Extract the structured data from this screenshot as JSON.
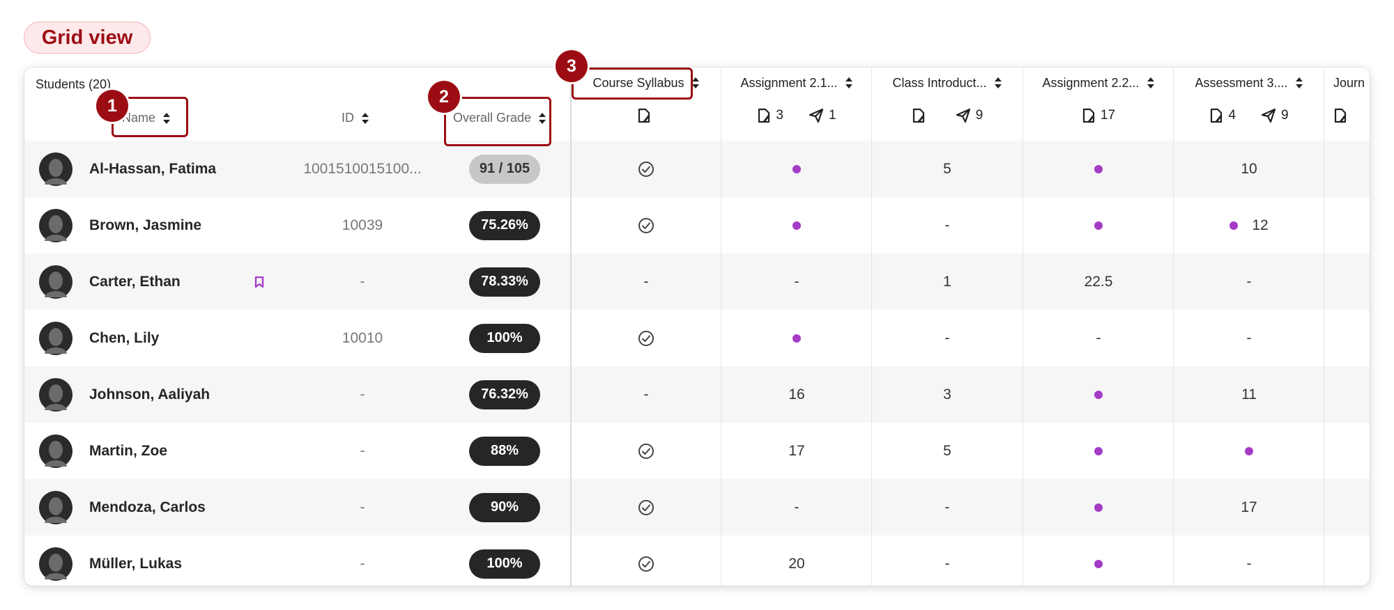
{
  "title": "Grid view",
  "header": {
    "students_label": "Students (20)",
    "name_label": "Name",
    "id_label": "ID",
    "overall_label": "Overall Grade"
  },
  "columns": [
    {
      "label": "Course Syllabus",
      "icons": [
        {
          "name": "document-icon",
          "count": ""
        }
      ]
    },
    {
      "label": "Assignment 2.1...",
      "icons": [
        {
          "name": "document-icon",
          "count": "3"
        },
        {
          "name": "send-icon",
          "count": "1"
        }
      ]
    },
    {
      "label": "Class Introduct...",
      "icons": [
        {
          "name": "document-icon",
          "count": ""
        },
        {
          "name": "send-icon",
          "count": "9"
        }
      ]
    },
    {
      "label": "Assignment 2.2...",
      "icons": [
        {
          "name": "document-icon",
          "count": "17"
        }
      ]
    },
    {
      "label": "Assessment 3....",
      "icons": [
        {
          "name": "document-icon",
          "count": "4"
        },
        {
          "name": "send-icon",
          "count": "9"
        }
      ]
    },
    {
      "label": "Journ",
      "icons": [
        {
          "name": "document-icon",
          "count": ""
        }
      ]
    }
  ],
  "students": [
    {
      "name": "Al-Hassan, Fatima",
      "id": "1001510015100...",
      "grade": "91 / 105",
      "grade_style": "light",
      "flag": false,
      "cells": [
        {
          "check": true
        },
        {
          "dot": true
        },
        {
          "text": "5"
        },
        {
          "dot": true
        },
        {
          "text": "10"
        }
      ]
    },
    {
      "name": "Brown, Jasmine",
      "id": "10039",
      "grade": "75.26%",
      "grade_style": "dark",
      "flag": false,
      "cells": [
        {
          "check": true
        },
        {
          "dot": true
        },
        {
          "text": "-"
        },
        {
          "dot": true
        },
        {
          "dot": true,
          "text": "12"
        }
      ]
    },
    {
      "name": "Carter, Ethan",
      "id": "-",
      "grade": "78.33%",
      "grade_style": "dark",
      "flag": true,
      "cells": [
        {
          "text": "-"
        },
        {
          "text": "-"
        },
        {
          "text": "1"
        },
        {
          "text": "22.5"
        },
        {
          "text": "-"
        }
      ]
    },
    {
      "name": "Chen, Lily",
      "id": "10010",
      "grade": "100%",
      "grade_style": "dark",
      "flag": false,
      "cells": [
        {
          "check": true
        },
        {
          "dot": true
        },
        {
          "text": "-"
        },
        {
          "text": "-"
        },
        {
          "text": "-"
        }
      ]
    },
    {
      "name": "Johnson, Aaliyah",
      "id": "-",
      "grade": "76.32%",
      "grade_style": "dark",
      "flag": false,
      "cells": [
        {
          "text": "-"
        },
        {
          "text": "16"
        },
        {
          "text": "3"
        },
        {
          "dot": true
        },
        {
          "text": "11"
        }
      ]
    },
    {
      "name": "Martin, Zoe",
      "id": "-",
      "grade": "88%",
      "grade_style": "dark",
      "flag": false,
      "cells": [
        {
          "check": true
        },
        {
          "text": "17"
        },
        {
          "text": "5"
        },
        {
          "dot": true
        },
        {
          "dot": true
        }
      ]
    },
    {
      "name": "Mendoza, Carlos",
      "id": "-",
      "grade": "90%",
      "grade_style": "dark",
      "flag": false,
      "cells": [
        {
          "check": true
        },
        {
          "text": "-"
        },
        {
          "text": "-"
        },
        {
          "dot": true
        },
        {
          "text": "17"
        }
      ]
    },
    {
      "name": "Müller, Lukas",
      "id": "-",
      "grade": "100%",
      "grade_style": "dark",
      "flag": false,
      "cells": [
        {
          "check": true
        },
        {
          "text": "20"
        },
        {
          "text": "-"
        },
        {
          "dot": true
        },
        {
          "text": "-"
        }
      ]
    }
  ],
  "callouts": [
    "1",
    "2",
    "3"
  ],
  "colors": {
    "accent": "#9c0d13",
    "dot": "#a43cc6",
    "grade_dark": "#262626"
  }
}
